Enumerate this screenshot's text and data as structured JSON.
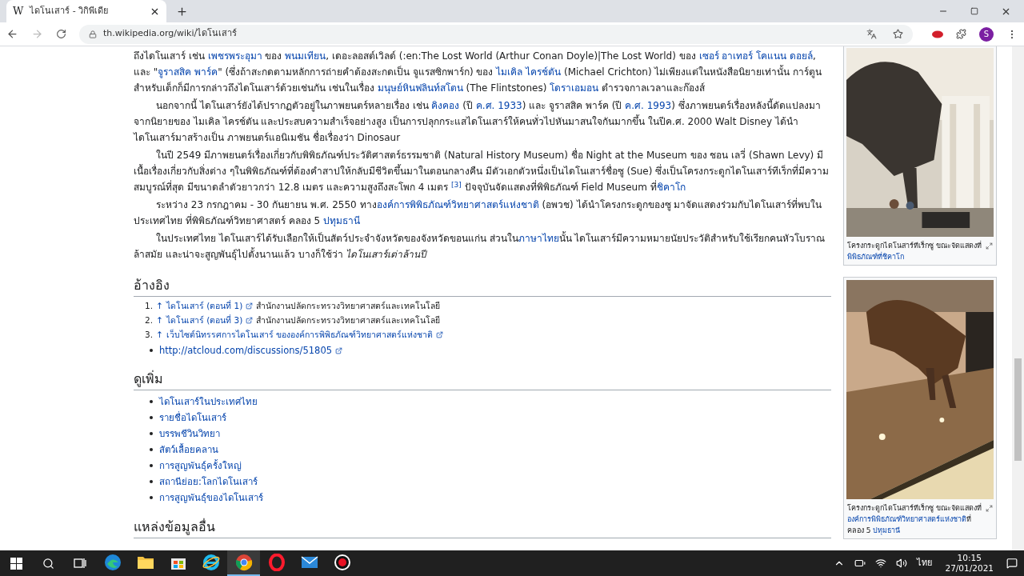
{
  "browser": {
    "tab": {
      "favicon": "W",
      "title": "ไดโนเสาร์ - วิกิพีเดีย"
    },
    "url": "th.wikipedia.org/wiki/ไดโนเสาร์",
    "profile": "S"
  },
  "article": {
    "paragraphs": [
      {
        "indent": false,
        "segments": [
          {
            "kind": "text",
            "text": "ถึงไดโนเสาร์ เช่น "
          },
          {
            "kind": "link",
            "text": "เพชรพระอุมา"
          },
          {
            "kind": "text",
            "text": " ของ "
          },
          {
            "kind": "link",
            "text": "พนมเทียน"
          },
          {
            "kind": "text",
            "text": ", เดอะลอสต์เวิลด์ (:en:The Lost World (Arthur Conan Doyle)|The Lost World) ของ "
          },
          {
            "kind": "link",
            "text": "เซอร์ อาเทอร์ โคแนน ดอยล์"
          },
          {
            "kind": "text",
            "text": ", และ \""
          },
          {
            "kind": "link",
            "text": "จูราสสิค พาร์ค"
          },
          {
            "kind": "text",
            "text": "\" (ซึ่งถ้าสะกดตามหลักการถ่ายคำต้องสะกดเป็น จูแรสซิกพาร์ก) ของ "
          },
          {
            "kind": "link",
            "text": "ไมเคิล ไครช์ตัน"
          },
          {
            "kind": "text",
            "text": " (Michael Crichton) ไม่เพียงแต่ในหนังสือนิยายเท่านั้น การ์ตูนสำหรับเด็กก็มีการกล่าวถึงไดโนเสาร์ด้วยเช่นกัน เช่นในเรื่อง "
          },
          {
            "kind": "link",
            "text": "มนุษย์หินฟลินท์สโตน"
          },
          {
            "kind": "text",
            "text": " (The Flintstones) "
          },
          {
            "kind": "link",
            "text": "โดราเอมอน"
          },
          {
            "kind": "text",
            "text": " ตำรวจกาลเวลาและก๊องส์"
          }
        ]
      },
      {
        "indent": true,
        "segments": [
          {
            "kind": "text",
            "text": "นอกจากนี้ ไดโนเสาร์ยังได้ปรากฏตัวอยู่ในภาพยนตร์หลายเรื่อง เช่น "
          },
          {
            "kind": "link",
            "text": "คิงคอง"
          },
          {
            "kind": "text",
            "text": " (ปี "
          },
          {
            "kind": "link",
            "text": "ค.ศ. 1933"
          },
          {
            "kind": "text",
            "text": ") และ จูราสสิค พาร์ค (ปี "
          },
          {
            "kind": "link",
            "text": "ค.ศ. 1993"
          },
          {
            "kind": "text",
            "text": ") ซึ่งภาพยนตร์เรื่องหลังนี้ดัดแปลงมาจากนิยายของ ไมเคิล ไครช์ตัน และประสบความสำเร็จอย่างสูง เป็นการปลุกกระแสไดโนเสาร์ให้คนทั่วไปหันมาสนใจกันมากขึ้น ในปีค.ศ. 2000 Walt Disney ได้นำไดโนเสาร์มาสร้างเป็น ภาพยนตร์แอนิเมชัน ชื่อเรื่องว่า Dinosaur"
          }
        ]
      },
      {
        "indent": true,
        "segments": [
          {
            "kind": "text",
            "text": "ในปี 2549 มีภาพยนตร์เรื่องเกี่ยวกับพิพิธภัณฑ์ประวัติศาสตร์ธรรมชาติ (Natural History Museum) ชื่อ Night at the Museum ของ ชอน เลวี่ (Shawn Levy) มีเนื้อเรื่องเกี่ยวกับสิ่งต่าง ๆในพิพิธภัณฑ์ที่ต้องคำสาปให้กลับมีชีวิตขึ้นมาในตอนกลางคืน มีตัวเอกตัวหนึ่งเป็นไดโนเสาร์ชื่อซู (Sue) ซึ่งเป็นโครงกระดูกไดโนเสาร์ทีเร็กที่มีความสมบูรณ์ที่สุด มีขนาดลำตัวยาวกว่า 12.8 เมตร และความสูงถึงสะโพก 4 เมตร "
          },
          {
            "kind": "ref",
            "text": "[3]"
          },
          {
            "kind": "text",
            "text": " ปัจจุบันจัดแสดงที่พิพิธภัณฑ์ Field Museum ที่"
          },
          {
            "kind": "link",
            "text": "ชิคาโก"
          }
        ]
      },
      {
        "indent": true,
        "segments": [
          {
            "kind": "text",
            "text": "ระหว่าง 23 กรกฎาคม - 30 กันยายน พ.ศ. 2550 ทาง"
          },
          {
            "kind": "link",
            "text": "องค์การพิพิธภัณฑ์วิทยาศาสตร์แห่งชาติ"
          },
          {
            "kind": "text",
            "text": " (อพวช) ได้นำโครงกระดูกของซู มาจัดแสดงร่วมกับไดโนเสาร์ที่พบในประเทศไทย ที่พิพิธภัณฑ์วิทยาศาสตร์ คลอง 5 "
          },
          {
            "kind": "link",
            "text": "ปทุมธานี"
          }
        ]
      },
      {
        "indent": true,
        "segments": [
          {
            "kind": "text",
            "text": "ในประเทศไทย ไดโนเสาร์ได้รับเลือกให้เป็นสัตว์ประจำจังหวัดของจังหวัดขอนแก่น ส่วนใน"
          },
          {
            "kind": "link",
            "text": "ภาษาไทย"
          },
          {
            "kind": "text",
            "text": "นั้น ไดโนเสาร์มีความหมายนัยประวัติสำหรับใช้เรียกคนหัวโบราณ ล้าสมัย และน่าจะสูญพันธุ์ไปตั้งนานแล้ว บางก็ใช้ว่า "
          },
          {
            "kind": "italic",
            "text": "ไดโนเสาร์เต่าล้านปี"
          }
        ]
      }
    ],
    "references": {
      "heading": "อ้างอิง",
      "items": [
        {
          "number": "1.",
          "mark": "↑",
          "link": "ไดโนเสาร์ (ตอนที่ 1)",
          "source": "สำนักงานปลัดกระทรวงวิทยาศาสตร์และเทคโนโลยี"
        },
        {
          "number": "2.",
          "mark": "↑",
          "link": "ไดโนเสาร์ (ตอนที่ 3)",
          "source": "สำนักงานปลัดกระทรวงวิทยาศาสตร์และเทคโนโลยี"
        },
        {
          "number": "3.",
          "mark": "↑",
          "link": "เว็บไซต์นิทรรศการไดโนเสาร์ ขององค์การพิพิธภัณฑ์วิทยาศาสตร์แห่งชาติ"
        }
      ],
      "external": [
        "http://atcloud.com/discussions/51805"
      ]
    },
    "see_also": {
      "heading": "ดูเพิ่ม",
      "items": [
        "ไดโนเสาร์ในประเทศไทย",
        "รายชื่อไดโนเสาร์",
        "บรรพชีวินวิทยา",
        "สัตว์เลื้อยคลาน",
        "การสูญพันธุ์ครั้งใหญ่",
        "สถานีย่อย:โลกไดโนเสาร์",
        "การสูญพันธุ์ของไดโนเสาร์"
      ]
    },
    "other_sources": {
      "heading": "แหล่งข้อมูลอื่น"
    }
  },
  "figures": [
    {
      "kind": "hall",
      "caption": [
        {
          "kind": "text",
          "text": "โครงกระดูกไดโนสาร์ทีเร็กซู ขณะจัดแสดงที่"
        },
        {
          "kind": "link",
          "text": "พิพิธภัณฑ์ที่ชิคาโก"
        }
      ]
    },
    {
      "kind": "dark",
      "caption": [
        {
          "kind": "text",
          "text": "โครงกระดูกไดโนสาร์ทีเร็กซู ขณะจัดแสดงที่"
        },
        {
          "kind": "link",
          "text": "องค์การพิพิธภัณฑ์วิทยาศาสตร์แห่งชาติ"
        },
        {
          "kind": "text",
          "text": "ที่คลอง 5 "
        },
        {
          "kind": "link",
          "text": "ปทุมธานี"
        }
      ]
    }
  ],
  "taskbar": {
    "apps": [
      {
        "kind": "edge",
        "selected": false
      },
      {
        "kind": "explorer",
        "selected": false
      },
      {
        "kind": "store",
        "selected": false
      },
      {
        "kind": "ie",
        "selected": false
      },
      {
        "kind": "chrome",
        "selected": true
      },
      {
        "kind": "opera",
        "selected": false
      },
      {
        "kind": "mail",
        "selected": false
      },
      {
        "kind": "record",
        "selected": false
      }
    ],
    "language": "ไทย",
    "time": "10:15",
    "date": "27/01/2021"
  }
}
